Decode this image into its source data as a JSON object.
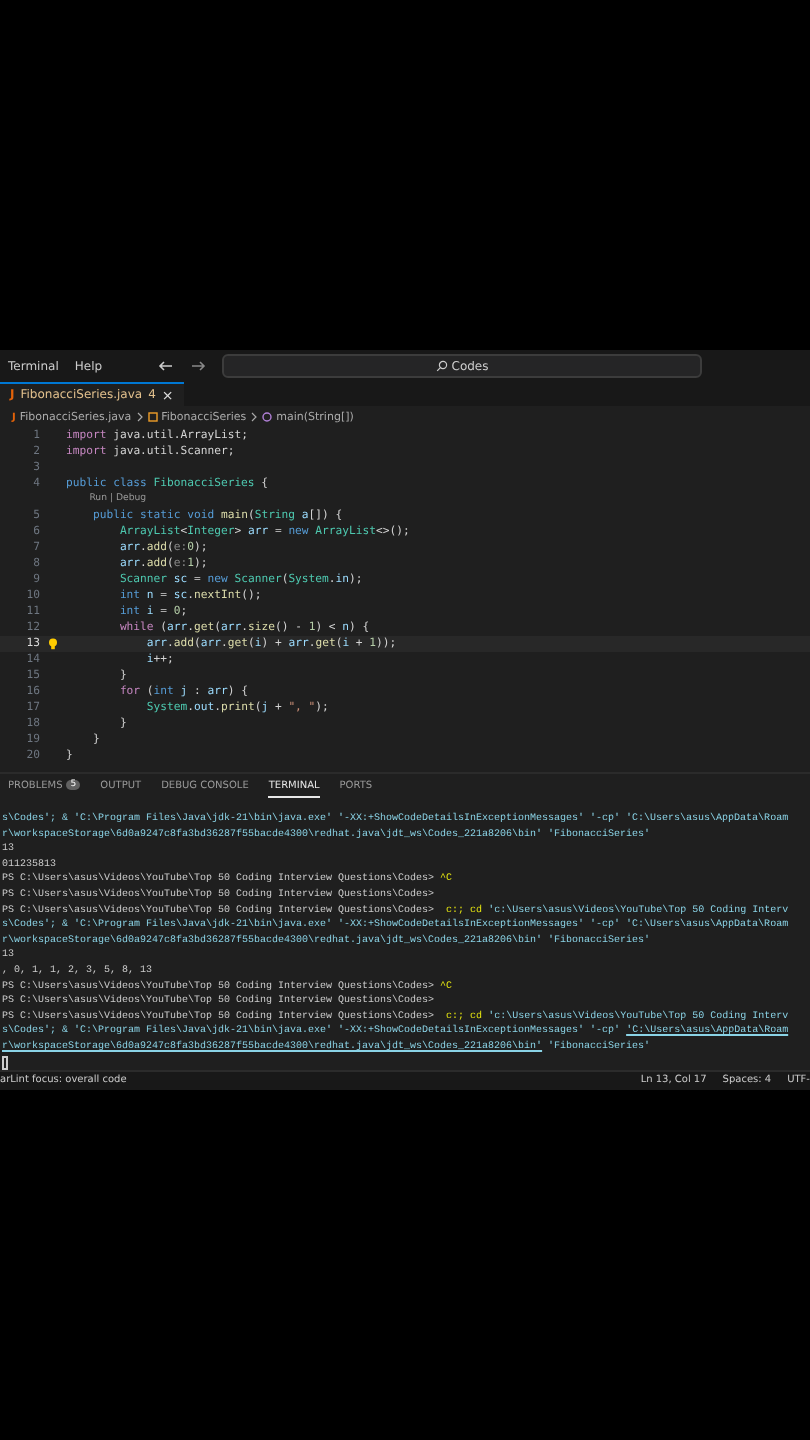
{
  "menu": [
    "Terminal",
    "Help"
  ],
  "search": {
    "value": "Codes"
  },
  "editor_tab": {
    "label": "FibonacciSeries.java",
    "badge": "4",
    "close": "×",
    "file_mark": "J"
  },
  "breadcrumb": [
    {
      "kind": "file",
      "mark": "J",
      "label": "FibonacciSeries.java"
    },
    {
      "kind": "class",
      "label": "FibonacciSeries"
    },
    {
      "kind": "method",
      "label": "main(String[])"
    }
  ],
  "code": [
    {
      "kind": "code",
      "number": "1",
      "segments": [
        {
          "kind": "control",
          "text": "import"
        },
        {
          "kind": "plain",
          "text": " java.util.ArrayList;"
        }
      ]
    },
    {
      "kind": "code",
      "number": "2",
      "segments": [
        {
          "kind": "control",
          "text": "import"
        },
        {
          "kind": "plain",
          "text": " java.util.Scanner;"
        }
      ]
    },
    {
      "kind": "code",
      "number": "3"
    },
    {
      "kind": "code",
      "number": "4",
      "segments": [
        {
          "kind": "keyword",
          "text": "public class "
        },
        {
          "kind": "type",
          "text": "FibonacciSeries"
        },
        {
          "kind": "plain",
          "text": " {"
        }
      ]
    },
    {
      "kind": "lens",
      "text": "Run | Debug"
    },
    {
      "kind": "code",
      "number": "5",
      "segments": [
        {
          "kind": "keyword",
          "text": "    public static void "
        },
        {
          "kind": "function",
          "text": "main"
        },
        {
          "kind": "plain",
          "text": "("
        },
        {
          "kind": "type",
          "text": "String"
        },
        {
          "kind": "variable",
          "text": " a"
        },
        {
          "kind": "plain",
          "text": "[]) {"
        }
      ]
    },
    {
      "kind": "code",
      "number": "6",
      "segments": [
        {
          "kind": "type",
          "text": "        ArrayList"
        },
        {
          "kind": "plain",
          "text": "<"
        },
        {
          "kind": "type",
          "text": "Integer"
        },
        {
          "kind": "plain",
          "text": "> "
        },
        {
          "kind": "variable",
          "text": "arr"
        },
        {
          "kind": "plain",
          "text": " = "
        },
        {
          "kind": "keyword",
          "text": "new "
        },
        {
          "kind": "type",
          "text": "ArrayList"
        },
        {
          "kind": "plain",
          "text": "<>();"
        }
      ]
    },
    {
      "kind": "code",
      "number": "7",
      "segments": [
        {
          "kind": "variable",
          "text": "        arr"
        },
        {
          "kind": "plain",
          "text": "."
        },
        {
          "kind": "function",
          "text": "add"
        },
        {
          "kind": "plain",
          "text": "("
        },
        {
          "kind": "hint",
          "text": "e:"
        },
        {
          "kind": "number",
          "text": "0"
        },
        {
          "kind": "plain",
          "text": ");"
        }
      ]
    },
    {
      "kind": "code",
      "number": "8",
      "segments": [
        {
          "kind": "variable",
          "text": "        arr"
        },
        {
          "kind": "plain",
          "text": "."
        },
        {
          "kind": "function",
          "text": "add"
        },
        {
          "kind": "plain",
          "text": "("
        },
        {
          "kind": "hint",
          "text": "e:"
        },
        {
          "kind": "number",
          "text": "1"
        },
        {
          "kind": "plain",
          "text": ");"
        }
      ]
    },
    {
      "kind": "code",
      "number": "9",
      "segments": [
        {
          "kind": "type",
          "text": "        Scanner"
        },
        {
          "kind": "variable",
          "text": " sc"
        },
        {
          "kind": "plain",
          "text": " = "
        },
        {
          "kind": "keyword",
          "text": "new "
        },
        {
          "kind": "type",
          "text": "Scanner"
        },
        {
          "kind": "plain",
          "text": "("
        },
        {
          "kind": "type",
          "text": "System"
        },
        {
          "kind": "plain",
          "text": "."
        },
        {
          "kind": "variable",
          "text": "in"
        },
        {
          "kind": "plain",
          "text": ");"
        }
      ]
    },
    {
      "kind": "code",
      "number": "10",
      "segments": [
        {
          "kind": "keyword",
          "text": "        int "
        },
        {
          "kind": "variable",
          "text": "n"
        },
        {
          "kind": "plain",
          "text": " = "
        },
        {
          "kind": "variable",
          "text": "sc"
        },
        {
          "kind": "plain",
          "text": "."
        },
        {
          "kind": "function",
          "text": "nextInt"
        },
        {
          "kind": "plain",
          "text": "();"
        }
      ]
    },
    {
      "kind": "code",
      "number": "11",
      "segments": [
        {
          "kind": "keyword",
          "text": "        int "
        },
        {
          "kind": "variable",
          "text": "i"
        },
        {
          "kind": "plain",
          "text": " = "
        },
        {
          "kind": "number",
          "text": "0"
        },
        {
          "kind": "plain",
          "text": ";"
        }
      ]
    },
    {
      "kind": "code",
      "number": "12",
      "segments": [
        {
          "kind": "control",
          "text": "        while"
        },
        {
          "kind": "plain",
          "text": " ("
        },
        {
          "kind": "variable",
          "text": "arr"
        },
        {
          "kind": "plain",
          "text": "."
        },
        {
          "kind": "function",
          "text": "get"
        },
        {
          "kind": "plain",
          "text": "("
        },
        {
          "kind": "variable",
          "text": "arr"
        },
        {
          "kind": "plain",
          "text": "."
        },
        {
          "kind": "function",
          "text": "size"
        },
        {
          "kind": "plain",
          "text": "() - "
        },
        {
          "kind": "number",
          "text": "1"
        },
        {
          "kind": "plain",
          "text": ") < "
        },
        {
          "kind": "variable",
          "text": "n"
        },
        {
          "kind": "plain",
          "text": ") {"
        }
      ]
    },
    {
      "kind": "code",
      "number": "13",
      "current": true,
      "lightbulb": true,
      "segments": [
        {
          "kind": "variable",
          "text": "            arr"
        },
        {
          "kind": "plain",
          "text": "."
        },
        {
          "kind": "function",
          "text": "add"
        },
        {
          "kind": "plain",
          "text": "("
        },
        {
          "kind": "variable",
          "text": "arr"
        },
        {
          "kind": "plain",
          "text": "."
        },
        {
          "kind": "function",
          "text": "get"
        },
        {
          "kind": "plain",
          "text": "("
        },
        {
          "kind": "variable",
          "text": "i"
        },
        {
          "kind": "plain",
          "text": ") + "
        },
        {
          "kind": "variable",
          "text": "arr"
        },
        {
          "kind": "plain",
          "text": "."
        },
        {
          "kind": "function",
          "text": "get"
        },
        {
          "kind": "plain",
          "text": "("
        },
        {
          "kind": "variable",
          "text": "i"
        },
        {
          "kind": "plain",
          "text": " + "
        },
        {
          "kind": "number",
          "text": "1"
        },
        {
          "kind": "plain",
          "text": "));"
        }
      ]
    },
    {
      "kind": "code",
      "number": "14",
      "segments": [
        {
          "kind": "variable",
          "text": "            i"
        },
        {
          "kind": "plain",
          "text": "++;"
        }
      ]
    },
    {
      "kind": "code",
      "number": "15",
      "segments": [
        {
          "kind": "plain",
          "text": "        }"
        }
      ]
    },
    {
      "kind": "code",
      "number": "16",
      "segments": [
        {
          "kind": "control",
          "text": "        for"
        },
        {
          "kind": "plain",
          "text": " ("
        },
        {
          "kind": "keyword",
          "text": "int "
        },
        {
          "kind": "variable",
          "text": "j"
        },
        {
          "kind": "plain",
          "text": " : "
        },
        {
          "kind": "variable",
          "text": "arr"
        },
        {
          "kind": "plain",
          "text": ") {"
        }
      ]
    },
    {
      "kind": "code",
      "number": "17",
      "segments": [
        {
          "kind": "type",
          "text": "            System"
        },
        {
          "kind": "plain",
          "text": "."
        },
        {
          "kind": "variable",
          "text": "out"
        },
        {
          "kind": "plain",
          "text": "."
        },
        {
          "kind": "function",
          "text": "print"
        },
        {
          "kind": "plain",
          "text": "("
        },
        {
          "kind": "variable",
          "text": "j"
        },
        {
          "kind": "plain",
          "text": " + "
        },
        {
          "kind": "string",
          "text": "\", \""
        },
        {
          "kind": "plain",
          "text": ");"
        }
      ]
    },
    {
      "kind": "code",
      "number": "18",
      "segments": [
        {
          "kind": "plain",
          "text": "        }"
        }
      ]
    },
    {
      "kind": "code",
      "number": "19",
      "segments": [
        {
          "kind": "plain",
          "text": "    }"
        }
      ]
    },
    {
      "kind": "code",
      "number": "20",
      "segments": [
        {
          "kind": "plain",
          "text": "}"
        }
      ]
    }
  ],
  "panel_tabs": [
    {
      "label": "PROBLEMS",
      "badge": "5",
      "selected": false
    },
    {
      "label": "OUTPUT",
      "selected": false
    },
    {
      "label": "DEBUG CONSOLE",
      "selected": false
    },
    {
      "label": "TERMINAL",
      "selected": true
    },
    {
      "label": "PORTS",
      "selected": false
    }
  ],
  "terminal": {
    "lines": [
      [
        {
          "kind": "path",
          "text": "s\\Codes'; & 'C:\\Program Files\\Java\\jdk-21\\bin\\java.exe' '-XX:+ShowCodeDetailsInExceptionMessages' '-cp' 'C:\\Users\\asus\\AppData\\Roam"
        }
      ],
      [
        {
          "kind": "path",
          "text": "r\\workspaceStorage\\6d0a9247c8fa3bd36287f55bacde4300\\redhat.java\\jdt_ws\\Codes_221a8206\\bin' 'FibonacciSeries'"
        }
      ],
      [
        {
          "kind": "plain",
          "text": "13"
        }
      ],
      [
        {
          "kind": "plain",
          "text": "011235813"
        }
      ],
      [
        {
          "kind": "plain",
          "text": "PS C:\\Users\\asus\\Videos\\YouTube\\Top 50 Coding Interview Questions\\Codes> "
        },
        {
          "kind": "command",
          "text": "^C"
        }
      ],
      [
        {
          "kind": "plain",
          "text": "PS C:\\Users\\asus\\Videos\\YouTube\\Top 50 Coding Interview Questions\\Codes>"
        }
      ],
      [
        {
          "kind": "plain",
          "text": "PS C:\\Users\\asus\\Videos\\YouTube\\Top 50 Coding Interview Questions\\Codes>  "
        },
        {
          "kind": "command",
          "text": "c:; cd"
        },
        {
          "kind": "path",
          "text": " 'c:\\Users\\asus\\Videos\\YouTube\\Top 50 Coding Interv"
        }
      ],
      [
        {
          "kind": "path",
          "text": "s\\Codes'; & 'C:\\Program Files\\Java\\jdk-21\\bin\\java.exe' '-XX:+ShowCodeDetailsInExceptionMessages' '-cp' 'C:\\Users\\asus\\AppData\\Roam"
        }
      ],
      [
        {
          "kind": "path",
          "text": "r\\workspaceStorage\\6d0a9247c8fa3bd36287f55bacde4300\\redhat.java\\jdt_ws\\Codes_221a8206\\bin' 'FibonacciSeries'"
        }
      ],
      [
        {
          "kind": "plain",
          "text": "13"
        }
      ],
      [
        {
          "kind": "plain",
          "text": ", 0, 1, 1, 2, 3, 5, 8, 13"
        }
      ],
      [
        {
          "kind": "plain",
          "text": "PS C:\\Users\\asus\\Videos\\YouTube\\Top 50 Coding Interview Questions\\Codes> "
        },
        {
          "kind": "command",
          "text": "^C"
        }
      ],
      [
        {
          "kind": "plain",
          "text": "PS C:\\Users\\asus\\Videos\\YouTube\\Top 50 Coding Interview Questions\\Codes>"
        }
      ],
      [
        {
          "kind": "plain",
          "text": "PS C:\\Users\\asus\\Videos\\YouTube\\Top 50 Coding Interview Questions\\Codes>  "
        },
        {
          "kind": "command",
          "text": "c:; cd"
        },
        {
          "kind": "path",
          "text": " 'c:\\Users\\asus\\Videos\\YouTube\\Top 50 Coding Interv"
        }
      ],
      [
        {
          "kind": "path",
          "text": "s\\Codes'; & 'C:\\Program Files\\Java\\jdk-21\\bin\\java.exe' '-XX:+ShowCodeDetailsInExceptionMessages' '-cp' "
        },
        {
          "kind": "link",
          "text": "'C:\\Users\\asus\\AppData\\Roam"
        }
      ],
      [
        {
          "kind": "link",
          "text": "r\\workspaceStorage\\6d0a9247c8fa3bd36287f55bacde4300\\redhat.java\\jdt_ws\\Codes_221a8206\\bin'"
        },
        {
          "kind": "path",
          "text": " 'FibonacciSeries'"
        }
      ]
    ],
    "cursor": true
  },
  "status_bar": {
    "left": "arLint focus: overall code",
    "right": [
      "Ln 13, Col 17",
      "Spaces: 4",
      "UTF-"
    ]
  }
}
